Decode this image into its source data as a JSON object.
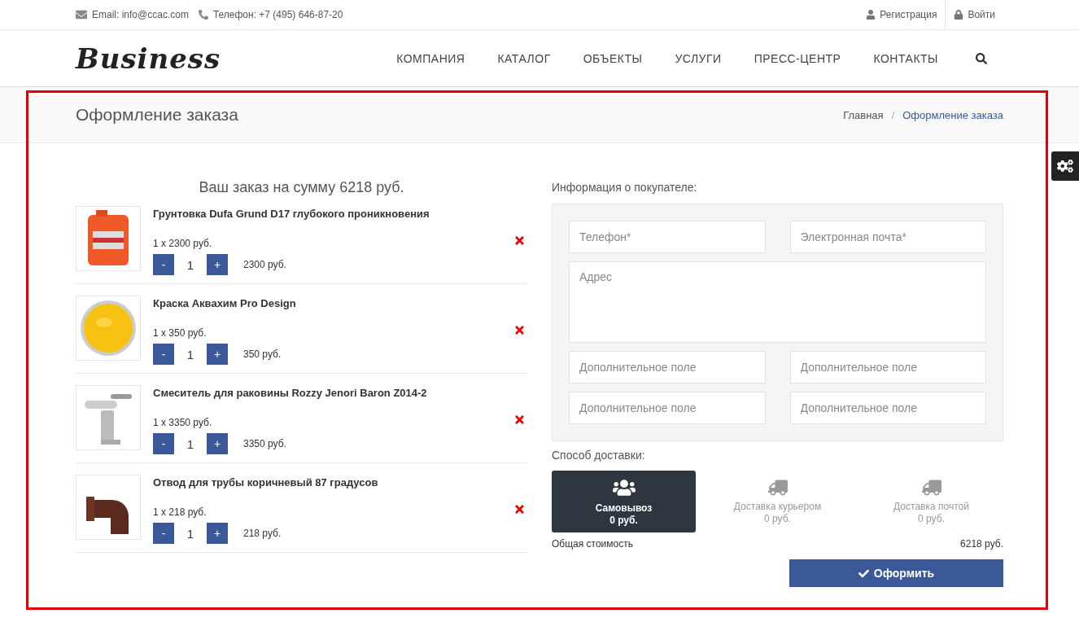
{
  "topbar": {
    "email": "Email: info@ccac.com",
    "phone": "Телефон: +7 (495) 646-87-20",
    "register": "Регистрация",
    "login": "Войти"
  },
  "logo": "Business",
  "nav": {
    "items": [
      {
        "label": "КОМПАНИЯ"
      },
      {
        "label": "КАТАЛОГ"
      },
      {
        "label": "ОБЪЕКТЫ"
      },
      {
        "label": "УСЛУГИ"
      },
      {
        "label": "ПРЕСС-ЦЕНТР"
      },
      {
        "label": "КОНТАКТЫ"
      }
    ]
  },
  "page_title": "Оформление заказа",
  "breadcrumbs": [
    {
      "label": "Главная",
      "current": false
    },
    {
      "label": "Оформление заказа",
      "current": true
    }
  ],
  "breadcrumb_separator": "/",
  "order": {
    "heading": "Ваш заказ на сумму 6218 руб.",
    "items": [
      {
        "name": "Грунтовка Dufa Grund D17 глубокого проникновения",
        "unit_price": "1 x 2300 руб.",
        "quantity": "1",
        "total": "2300 руб.",
        "minus": "-",
        "plus": "+"
      },
      {
        "name": "Краска Аквахим Pro Design",
        "unit_price": "1 x 350 руб.",
        "quantity": "1",
        "total": "350 руб.",
        "minus": "-",
        "plus": "+"
      },
      {
        "name": "Смеситель для раковины Rozzy Jenori Baron Z014-2",
        "unit_price": "1 x 3350 руб.",
        "quantity": "1",
        "total": "3350 руб.",
        "minus": "-",
        "plus": "+"
      },
      {
        "name": "Отвод для трубы коричневый 87 градусов",
        "unit_price": "1 x 218 руб.",
        "quantity": "1",
        "total": "218 руб.",
        "minus": "-",
        "plus": "+"
      }
    ]
  },
  "buyer": {
    "heading": "Информация о покупателе:",
    "fields": [
      {
        "kind": "input",
        "placeholder": "Телефон*"
      },
      {
        "kind": "input",
        "placeholder": "Электронная почта*"
      },
      {
        "kind": "textarea",
        "placeholder": "Адрес"
      },
      {
        "kind": "input",
        "placeholder": "Дополнительное поле"
      },
      {
        "kind": "input",
        "placeholder": "Дополнительное поле"
      },
      {
        "kind": "input",
        "placeholder": "Дополнительное поле"
      },
      {
        "kind": "input",
        "placeholder": "Дополнительное поле"
      }
    ]
  },
  "delivery": {
    "heading": "Способ доставки:",
    "options": [
      {
        "kind": "pickup",
        "label": "Самовывоз",
        "price": "0 руб.",
        "selected": true
      },
      {
        "kind": "shipping",
        "label": "Доставка курьером",
        "price": "0 руб.",
        "selected": false
      },
      {
        "kind": "shipping",
        "label": "Доставка почтой",
        "price": "0 руб.",
        "selected": false
      }
    ]
  },
  "total": {
    "label": "Общая стоимость",
    "value": "6218 руб."
  },
  "submit": "Оформить"
}
